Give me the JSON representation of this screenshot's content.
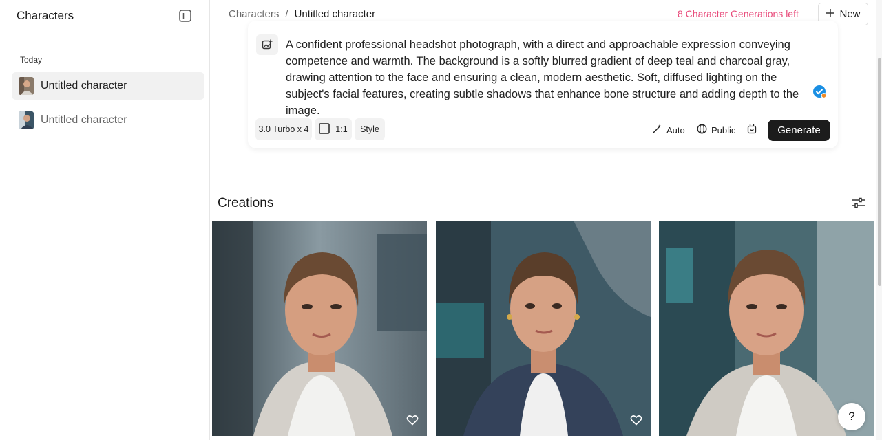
{
  "sidebar": {
    "title": "Characters",
    "section": "Today",
    "items": [
      {
        "label": "Untitled character",
        "active": true
      },
      {
        "label": "Untitled character",
        "active": false
      }
    ]
  },
  "header": {
    "breadcrumb_root": "Characters",
    "breadcrumb_separator": "/",
    "breadcrumb_current": "Untitled character",
    "generations_left": "8 Character Generations left",
    "new_label": "New"
  },
  "prompt": {
    "text": "A confident professional headshot photograph, with a direct and approachable expression conveying competence and warmth. The background is a softly blurred gradient of deep teal and charcoal gray, drawing attention to the face and ensuring a clean, modern aesthetic. Soft, diffused lighting on the subject's facial features, creating subtle shadows that enhance bone structure and adding depth to the image.",
    "model_label": "3.0 Turbo x 4",
    "aspect_label": "1:1",
    "style_label": "Style",
    "auto_label": "Auto",
    "visibility_label": "Public",
    "generate_label": "Generate"
  },
  "creations": {
    "title": "Creations",
    "images": [
      {
        "name": "creation-1"
      },
      {
        "name": "creation-2"
      },
      {
        "name": "creation-3"
      }
    ]
  },
  "help_label": "?",
  "colors": {
    "accent_pink": "#e84a7a",
    "badge_blue": "#1a8fe3",
    "badge_orange": "#f08a24",
    "generate_bg": "#1c1c1c"
  }
}
